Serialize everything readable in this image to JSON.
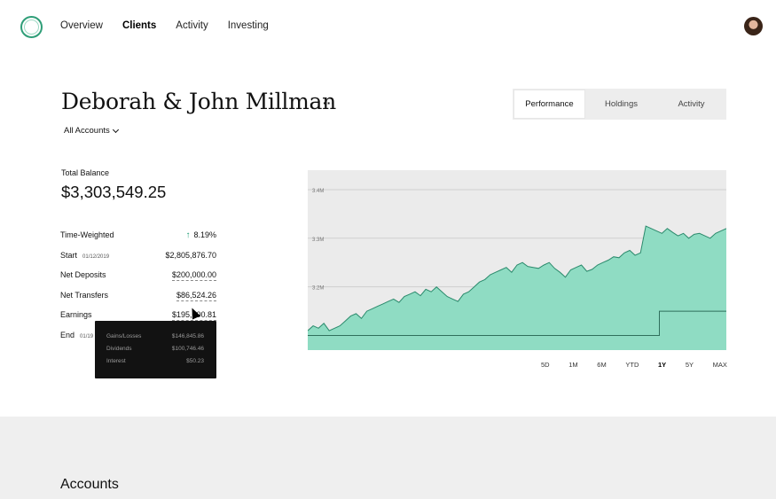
{
  "nav": {
    "items": [
      "Overview",
      "Clients",
      "Activity",
      "Investing"
    ],
    "active": "Clients"
  },
  "client": {
    "name": "Deborah & John Millman",
    "accounts_select": "All Accounts"
  },
  "tabs": {
    "items": [
      "Performance",
      "Holdings",
      "Activity"
    ],
    "active": "Performance"
  },
  "balance": {
    "label": "Total Balance",
    "value": "$3,303,549.25"
  },
  "stats": {
    "time_weighted": {
      "label": "Time-Weighted",
      "value": "8.19%"
    },
    "start": {
      "label": "Start",
      "date": "01/12/2019",
      "value": "$2,805,876.70"
    },
    "net_deposits": {
      "label": "Net Deposits",
      "value": "$200,000.00"
    },
    "net_transfers": {
      "label": "Net Transfers",
      "value": "$86,524.26"
    },
    "earnings": {
      "label": "Earnings",
      "value": "$195,000.81"
    },
    "end": {
      "label": "End",
      "date": "01/19"
    }
  },
  "tooltip": {
    "rows": [
      {
        "label": "Gains/Losses",
        "value": "$146,845.86"
      },
      {
        "label": "Dividends",
        "value": "$100,746.46"
      },
      {
        "label": "Interest",
        "value": "$50.23"
      }
    ]
  },
  "chart_data": {
    "type": "area",
    "ytick_labels": [
      "3.4M",
      "3.3M",
      "3.2M",
      "3.1M"
    ],
    "ylim": [
      3.07,
      3.44
    ],
    "grid": true,
    "fill_color": "#8fdcc3",
    "line_color": "#2b8a6c",
    "series": [
      {
        "values": [
          3.11,
          3.12,
          3.115,
          3.125,
          3.11,
          3.115,
          3.12,
          3.13,
          3.14,
          3.145,
          3.135,
          3.15,
          3.155,
          3.16,
          3.165,
          3.17,
          3.175,
          3.168,
          3.18,
          3.185,
          3.19,
          3.182,
          3.195,
          3.19,
          3.2,
          3.19,
          3.18,
          3.175,
          3.17,
          3.185,
          3.19,
          3.2,
          3.21,
          3.215,
          3.225,
          3.23,
          3.235,
          3.24,
          3.23,
          3.245,
          3.25,
          3.242,
          3.24,
          3.238,
          3.245,
          3.25,
          3.238,
          3.23,
          3.22,
          3.235,
          3.24,
          3.245,
          3.232,
          3.236,
          3.245,
          3.25,
          3.255,
          3.262,
          3.26,
          3.27,
          3.275,
          3.265,
          3.27,
          3.325,
          3.32,
          3.315,
          3.31,
          3.32,
          3.312,
          3.305,
          3.31,
          3.3,
          3.308,
          3.31,
          3.305,
          3.3,
          3.31,
          3.315,
          3.32
        ]
      }
    ],
    "steps": [
      {
        "values": [
          3.1,
          3.1,
          3.15,
          3.15
        ]
      }
    ],
    "ranges": [
      "5D",
      "1M",
      "6M",
      "YTD",
      "1Y",
      "5Y",
      "MAX"
    ],
    "active_range": "1Y"
  },
  "accounts": {
    "title": "Accounts"
  }
}
